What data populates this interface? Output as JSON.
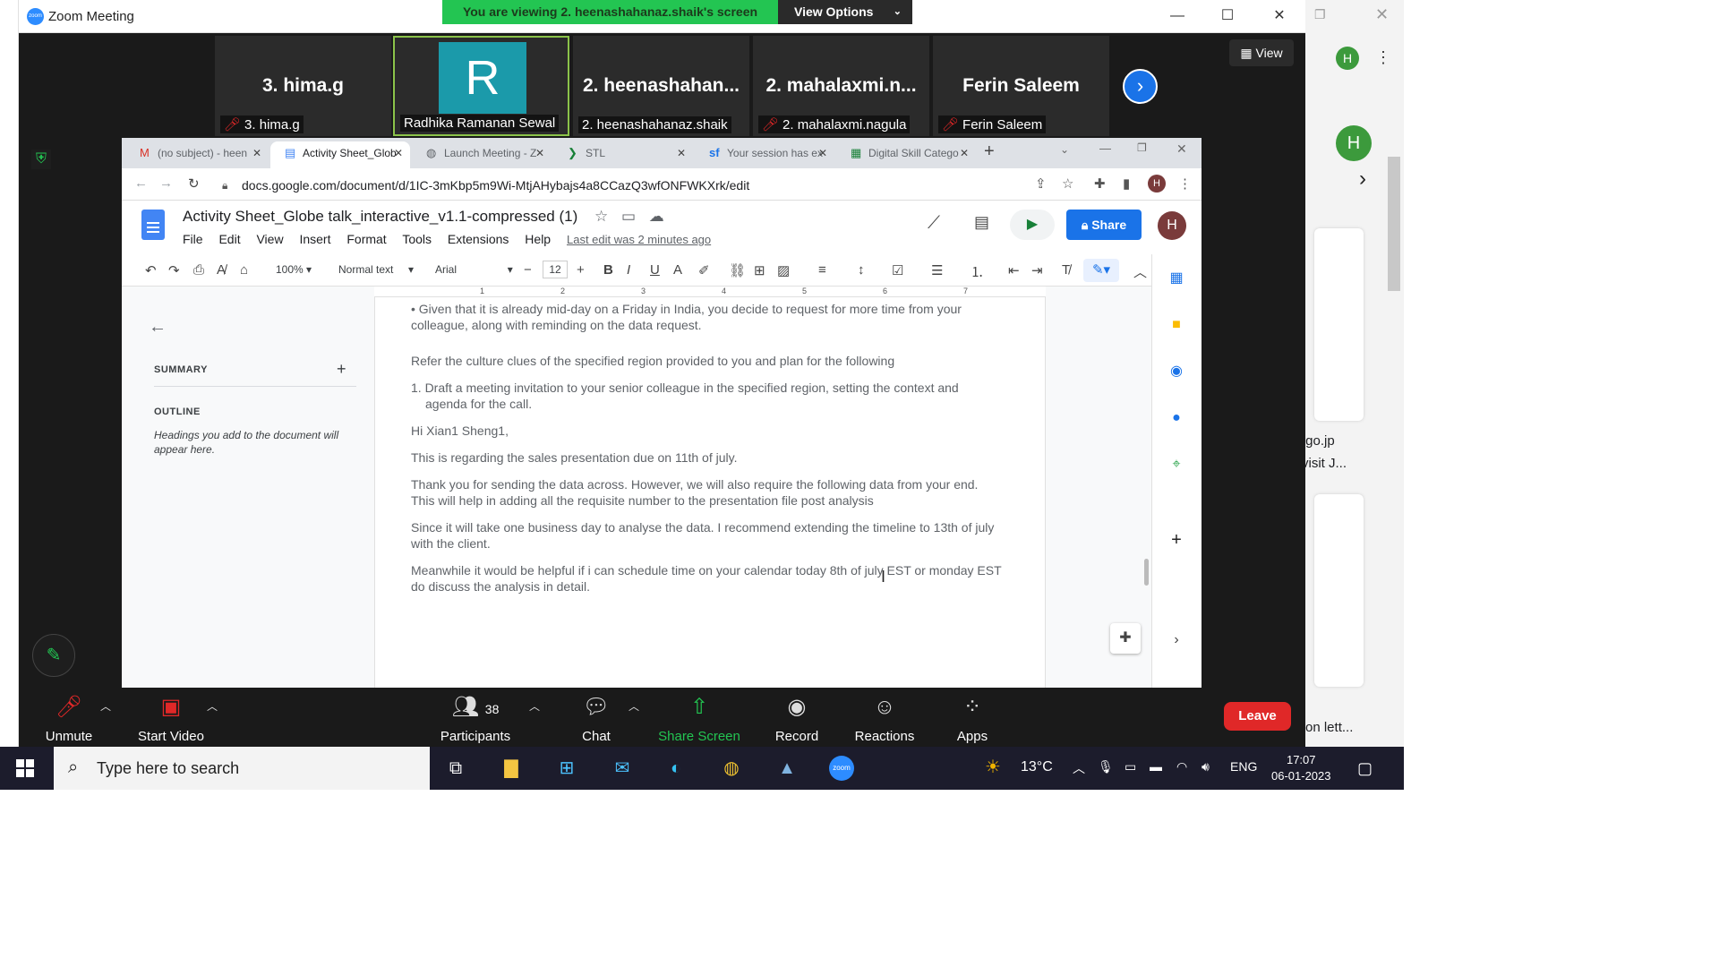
{
  "zoom": {
    "window_title": "Zoom Meeting",
    "viewing_banner": "You are viewing 2. heenashahanaz.shaik's screen",
    "view_options": "View Options",
    "view_button": "View",
    "tiles": [
      {
        "big": "3. hima.g",
        "small": "3. hima.g",
        "muted": true
      },
      {
        "big": "R",
        "small": "Radhika Ramanan Sewal",
        "muted": false,
        "active": true
      },
      {
        "big": "2.  heenashahan...",
        "small": "2. heenashahanaz.shaik",
        "muted": false
      },
      {
        "big": "2.  mahalaxmi.n...",
        "small": "2. mahalaxmi.nagula",
        "muted": true
      },
      {
        "big": "Ferin Saleem",
        "small": "Ferin Saleem",
        "muted": true
      }
    ],
    "toolbar": {
      "unmute": "Unmute",
      "start_video": "Start Video",
      "participants": "Participants",
      "participant_count": "38",
      "chat": "Chat",
      "share_screen": "Share Screen",
      "record": "Record",
      "reactions": "Reactions",
      "apps": "Apps",
      "leave": "Leave"
    },
    "colors": {
      "accent_green": "#23c552",
      "leave_red": "#e02828",
      "zoom_blue": "#2d8cff"
    }
  },
  "chrome": {
    "tabs": [
      {
        "label": "(no subject) - heen",
        "icon": "gmail-icon"
      },
      {
        "label": "Activity Sheet_Glob",
        "icon": "docs-icon",
        "active": true
      },
      {
        "label": "Launch Meeting - Z",
        "icon": "globe-icon"
      },
      {
        "label": "STL",
        "icon": "stl-icon"
      },
      {
        "label": "Your session has ex",
        "icon": "salesforce-icon"
      },
      {
        "label": "Digital Skill Catego",
        "icon": "sheets-icon"
      }
    ],
    "url": "docs.google.com/document/d/1IC-3mKbp5m9Wi-MtjAHybajs4a8CCazQ3wfONFWKXrk/edit"
  },
  "docs": {
    "title": "Activity Sheet_Globe talk_interactive_v1.1-compressed (1)",
    "menu": [
      "File",
      "Edit",
      "View",
      "Insert",
      "Format",
      "Tools",
      "Extensions",
      "Help"
    ],
    "last_edit": "Last edit was 2 minutes ago",
    "share": "Share",
    "avatar_letter": "H",
    "toolbar": {
      "zoom": "100%",
      "style": "Normal text",
      "font": "Arial",
      "font_size": "12"
    },
    "ruler": [
      "1",
      "2",
      "3",
      "4",
      "5",
      "6",
      "7"
    ],
    "outline": {
      "summary": "SUMMARY",
      "outline": "OUTLINE",
      "hint": "Headings you add to the document will appear here."
    },
    "paragraphs": [
      "• Given that it is already mid-day on a Friday in India, you decide to request for more time from your colleague, along with reminding on the data request.",
      "Refer the culture clues of the specified region provided to you and plan for the following",
      "1. Draft a meeting invitation to your senior colleague in the specified region, setting the context and agenda for the call.",
      "Hi Xian1 Sheng1,",
      "This is regarding the sales presentation due on 11th of july.",
      "Thank you for sending the data across. However, we will also require the following data from your end. This will help in adding all the requisite number to the presentation file post analysis",
      "Since it will take one business day to analyse the data. I recommend extending the timeline to 13th of july with the client.",
      "Meanwhile it would be helpful if i can schedule time on your calendar today 8th of july EST or monday EST do discuss the analysis in detail."
    ]
  },
  "background": {
    "right_text_1": ".go.jp",
    "right_text_2": "visit J...",
    "right_text_3": "on lett...",
    "avatar_letter": "H"
  },
  "taskbar": {
    "search_placeholder": "Type here to search",
    "temperature": "13°C",
    "language": "ENG",
    "time": "17:07",
    "date": "06-01-2023"
  }
}
